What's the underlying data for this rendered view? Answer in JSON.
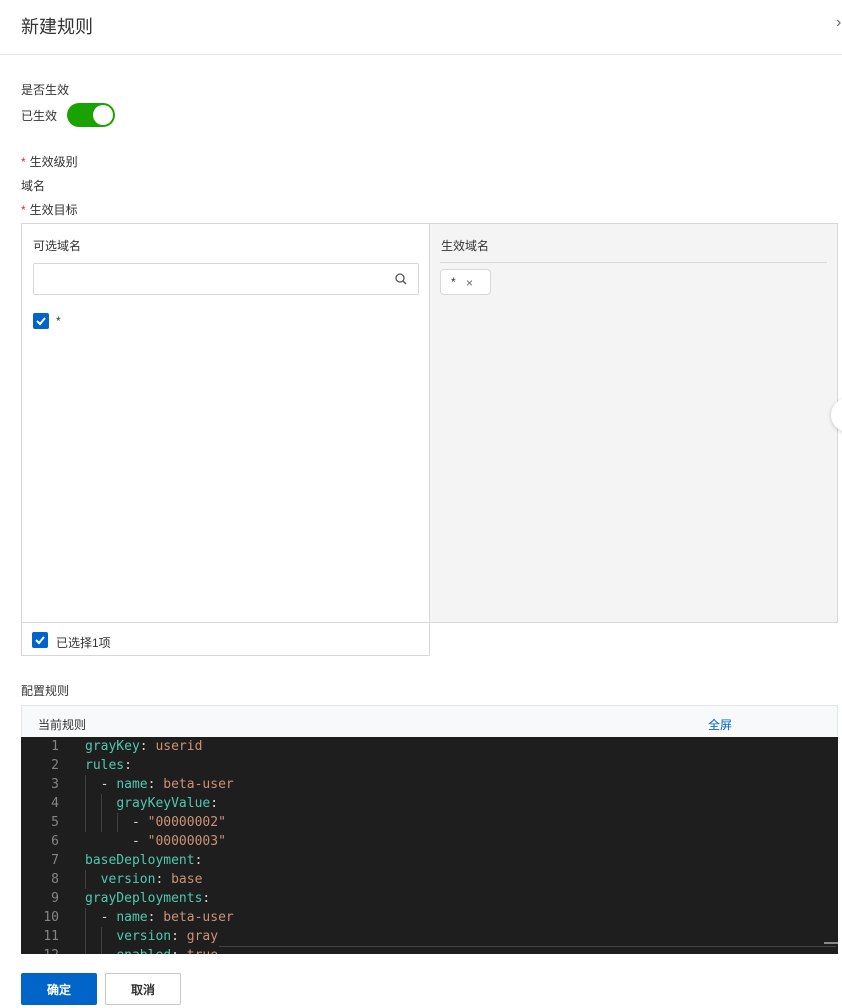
{
  "dialog": {
    "title": "新建规则",
    "close_icon": "close-icon"
  },
  "form": {
    "active_label": "是否生效",
    "active_status": "已生效",
    "active_on": true,
    "level_label": "生效级别",
    "level_value": "域名",
    "target_label": "生效目标",
    "required_mark": "*"
  },
  "transfer": {
    "left_title": "可选域名",
    "search_placeholder": "",
    "options": [
      {
        "label": "*",
        "checked": true
      }
    ],
    "right_title": "生效域名",
    "selected_tags": [
      {
        "label": "*",
        "remove": "×"
      }
    ],
    "footer_text": "已选择1项",
    "footer_checked": true
  },
  "config": {
    "label": "配置规则",
    "editor_title": "当前规则",
    "fullscreen": "全屏",
    "lines": [
      {
        "n": "1",
        "parts": [
          [
            "k",
            "grayKey"
          ],
          [
            "p",
            ": "
          ],
          [
            "v",
            "userid"
          ]
        ]
      },
      {
        "n": "2",
        "parts": [
          [
            "k",
            "rules"
          ],
          [
            "p",
            ":"
          ]
        ]
      },
      {
        "n": "3",
        "parts": [
          [
            "p",
            "  - "
          ],
          [
            "k",
            "name"
          ],
          [
            "p",
            ": "
          ],
          [
            "v",
            "beta-user"
          ]
        ]
      },
      {
        "n": "4",
        "parts": [
          [
            "p",
            "    "
          ],
          [
            "k",
            "grayKeyValue"
          ],
          [
            "p",
            ":"
          ]
        ]
      },
      {
        "n": "5",
        "parts": [
          [
            "p",
            "      - "
          ],
          [
            "v",
            "\"00000002\""
          ]
        ]
      },
      {
        "n": "6",
        "parts": [
          [
            "p",
            "      - "
          ],
          [
            "v",
            "\"00000003\""
          ]
        ]
      },
      {
        "n": "7",
        "parts": [
          [
            "k",
            "baseDeployment"
          ],
          [
            "p",
            ":"
          ]
        ]
      },
      {
        "n": "8",
        "parts": [
          [
            "p",
            "  "
          ],
          [
            "k",
            "version"
          ],
          [
            "p",
            ": "
          ],
          [
            "v",
            "base"
          ]
        ]
      },
      {
        "n": "9",
        "parts": [
          [
            "k",
            "grayDeployments"
          ],
          [
            "p",
            ":"
          ]
        ]
      },
      {
        "n": "10",
        "parts": [
          [
            "p",
            "  - "
          ],
          [
            "k",
            "name"
          ],
          [
            "p",
            ": "
          ],
          [
            "v",
            "beta-user"
          ]
        ]
      },
      {
        "n": "11",
        "parts": [
          [
            "p",
            "    "
          ],
          [
            "k",
            "version"
          ],
          [
            "p",
            ": "
          ],
          [
            "v",
            "gray"
          ]
        ]
      },
      {
        "n": "12",
        "parts": [
          [
            "p",
            "    "
          ],
          [
            "k",
            "enabled"
          ],
          [
            "p",
            ": "
          ],
          [
            "v",
            "true"
          ]
        ]
      }
    ]
  },
  "footer": {
    "confirm": "确定",
    "cancel": "取消"
  },
  "colors": {
    "primary": "#0064c8",
    "switch_on": "#1aa300",
    "editor_bg": "#1e1e1e",
    "key": "#4ec9b0",
    "value": "#ce9178"
  }
}
